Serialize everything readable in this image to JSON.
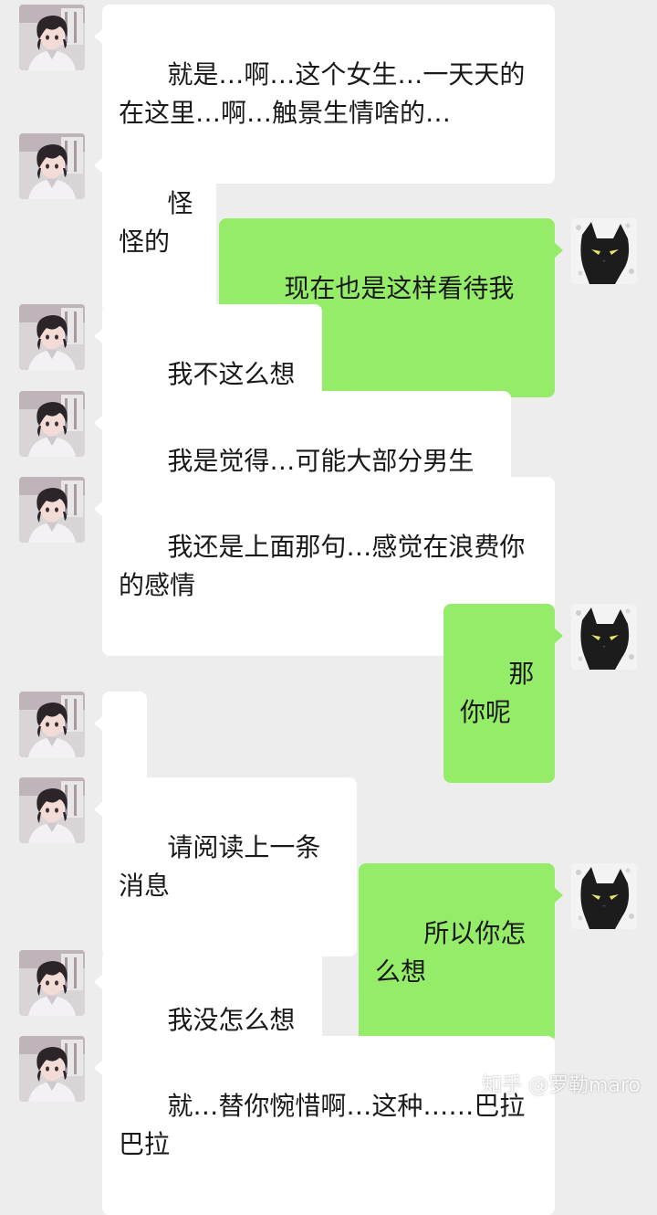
{
  "messages": [
    {
      "side": "in",
      "text": "就是…啊…这个女生…一天天的在这里…啊…触景生情啥的…"
    },
    {
      "side": "in",
      "text": "怪怪的"
    },
    {
      "side": "out",
      "text": "现在也是这样看待我的吗"
    },
    {
      "side": "in",
      "text": "我不这么想啊…"
    },
    {
      "side": "in",
      "text": "我是觉得…可能大部分男生吧…"
    },
    {
      "side": "in",
      "text": "我还是上面那句…感觉在浪费你的感情"
    },
    {
      "side": "out",
      "text": "那你呢"
    },
    {
      "side": "in",
      "text": "？"
    },
    {
      "side": "in",
      "text": "请阅读上一条消息"
    },
    {
      "side": "out",
      "text": "所以你怎么想"
    },
    {
      "side": "in",
      "text": "我没怎么想啊…"
    },
    {
      "side": "in",
      "text": "就…替你惋惜啊…这种……巴拉巴拉"
    }
  ],
  "watermark": "知乎 @罗勒maro",
  "colors": {
    "background": "#ededed",
    "incoming": "#ffffff",
    "outgoing": "#95ec69"
  },
  "icons": {
    "contact_avatar": "anime-boy-avatar",
    "self_avatar": "black-cat-avatar"
  }
}
